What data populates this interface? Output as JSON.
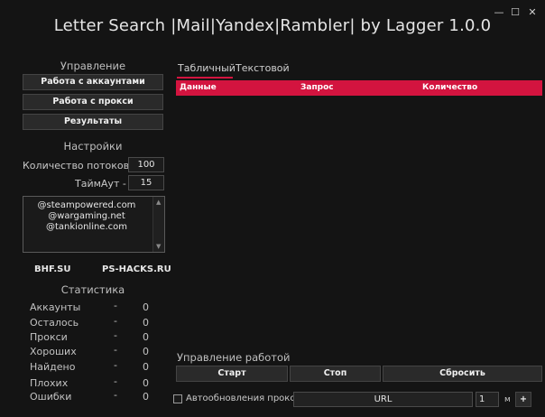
{
  "window": {
    "title": "Letter Search |Mail|Yandex|Rambler| by Lagger 1.0.0",
    "minimize": "—",
    "maximize": "☐",
    "close": "✕"
  },
  "control": {
    "heading": "Управление",
    "accounts_button": "Работа с аккаунтами",
    "proxy_button": "Работа с прокси",
    "results_button": "Результаты"
  },
  "settings": {
    "heading": "Настройки",
    "threads_label": "Количество потоков -",
    "threads_value": "100",
    "timeout_label": "ТаймАут -",
    "timeout_value": "15"
  },
  "domains": [
    "@steampowered.com",
    "@wargaming.net",
    "@tankionline.com"
  ],
  "links": {
    "left": "BHF.SU",
    "right": "PS-HACKS.RU"
  },
  "stats": {
    "heading": "Статистика",
    "rows": [
      {
        "label": "Аккаунты",
        "dash": "-",
        "value": "0"
      },
      {
        "label": "Осталось",
        "dash": "-",
        "value": "0"
      },
      {
        "label": "Прокси",
        "dash": "-",
        "value": "0"
      },
      {
        "label": "Хороших",
        "dash": "-",
        "value": "0"
      },
      {
        "label": "Найдено",
        "dash": "-",
        "value": "0"
      },
      {
        "label": "Плохих",
        "dash": "-",
        "value": "0"
      },
      {
        "label": "Ошибки",
        "dash": "-",
        "value": "0"
      }
    ]
  },
  "tabs": {
    "table": "Табличный",
    "text": "Текстовой"
  },
  "table": {
    "columns": [
      "Данные",
      "Запрос",
      "Количество"
    ]
  },
  "work": {
    "heading": "Управление работой",
    "start": "Старт",
    "stop": "Стоп",
    "reset": "Сбросить"
  },
  "proxy_update": {
    "label": "Автообновления прокси -",
    "url_value": "URL",
    "interval_value": "1",
    "unit": "м",
    "add": "+"
  },
  "colors": {
    "accent": "#d3143f",
    "background": "#141414"
  }
}
